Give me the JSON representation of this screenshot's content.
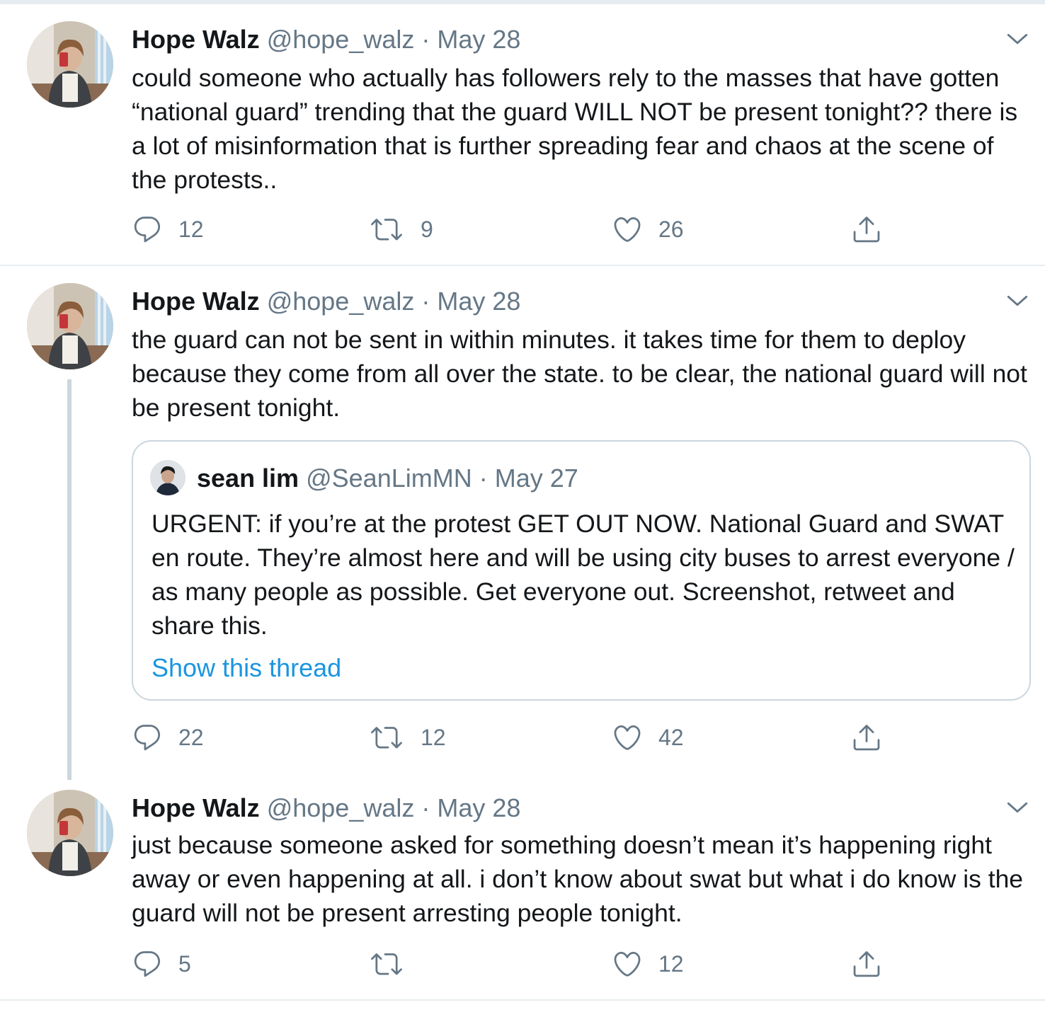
{
  "colors": {
    "text": "#14171a",
    "muted": "#657786",
    "link": "#1b95e0",
    "border": "#ccd6dd",
    "divider": "#e6ecf0"
  },
  "tweets": [
    {
      "name": "Hope Walz",
      "handle": "@hope_walz",
      "sep": "·",
      "date": "May 28",
      "text": "could someone who actually has followers rely to the masses that have gotten “national guard” trending that the guard WILL NOT be present tonight?? there is a lot of misinformation that is further spreading fear and chaos at the scene of the protests..",
      "replies": "12",
      "retweets": "9",
      "likes": "26",
      "icons": [
        "reply-icon",
        "retweet-icon",
        "like-icon",
        "share-icon",
        "chevron-down-icon"
      ]
    },
    {
      "name": "Hope Walz",
      "handle": "@hope_walz",
      "sep": "·",
      "date": "May 28",
      "text": "the guard can not be sent in within minutes. it takes time for them to deploy because they come from all over the state. to be clear, the national guard will not be present tonight.",
      "replies": "22",
      "retweets": "12",
      "likes": "42",
      "quote": {
        "name": "sean lim",
        "handle": "@SeanLimMN",
        "sep": "·",
        "date": "May 27",
        "text": "URGENT: if you’re at the protest GET OUT NOW. National Guard and SWAT en route. They’re almost here and will be using city buses to arrest everyone / as many people as possible. Get everyone out. Screenshot, retweet and share this.",
        "link": "Show this thread"
      }
    },
    {
      "name": "Hope Walz",
      "handle": "@hope_walz",
      "sep": "·",
      "date": "May 28",
      "text": "just because someone asked for something doesn’t mean it’s happening right away or even happening at all. i don’t know about swat but what i do know is the guard will not be present arresting people tonight.",
      "replies": "5",
      "retweets": "",
      "likes": "12"
    }
  ]
}
